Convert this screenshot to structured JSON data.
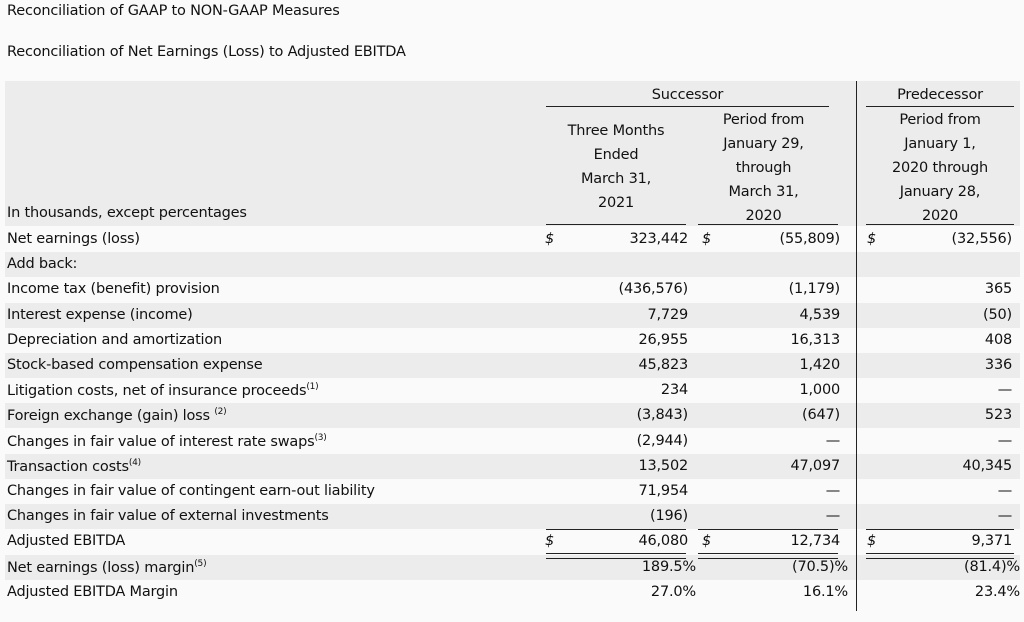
{
  "titles": {
    "main": "Reconciliation of GAAP to NON-GAAP Measures",
    "sub": "Reconciliation of Net Earnings (Loss) to Adjusted EBITDA"
  },
  "header": {
    "successor": "Successor",
    "predecessor": "Predecessor",
    "col1": [
      "Three Months",
      "Ended",
      "March 31,",
      "2021"
    ],
    "col2": [
      "Period from",
      "January 29,",
      "through",
      "March 31,",
      "2020"
    ],
    "col3": [
      "Period from",
      "January 1,",
      "2020 through",
      "January 28,",
      "2020"
    ],
    "units_label": "In thousands, except percentages"
  },
  "rows": [
    {
      "label": "Net earnings (loss)",
      "sup": "",
      "c1": "323,442",
      "c2": "(55,809)",
      "c3": "(32,556)",
      "dollar": "$"
    },
    {
      "label": "Add back:",
      "sup": "",
      "c1": "",
      "c2": "",
      "c3": ""
    },
    {
      "label": "Income tax (benefit) provision",
      "sup": "",
      "c1": "(436,576)",
      "c2": "(1,179)",
      "c3": "365"
    },
    {
      "label": "Interest expense (income)",
      "sup": "",
      "c1": "7,729",
      "c2": "4,539",
      "c3": "(50)"
    },
    {
      "label": "Depreciation and amortization",
      "sup": "",
      "c1": "26,955",
      "c2": "16,313",
      "c3": "408"
    },
    {
      "label": "Stock-based compensation expense",
      "sup": "",
      "c1": "45,823",
      "c2": "1,420",
      "c3": "336"
    },
    {
      "label": "Litigation costs, net of insurance proceeds",
      "sup": "(1)",
      "c1": "234",
      "c2": "1,000",
      "c3": "—"
    },
    {
      "label": "Foreign exchange (gain) loss ",
      "sup": "(2)",
      "c1": "(3,843)",
      "c2": "(647)",
      "c3": "523"
    },
    {
      "label": "Changes in fair value of interest rate swaps",
      "sup": "(3)",
      "c1": "(2,944)",
      "c2": "—",
      "c3": "—"
    },
    {
      "label": "Transaction costs",
      "sup": "(4)",
      "c1": "13,502",
      "c2": "47,097",
      "c3": "40,345"
    },
    {
      "label": "Changes in fair value of contingent earn-out liability",
      "sup": "",
      "c1": "71,954",
      "c2": "—",
      "c3": "—"
    },
    {
      "label": "Changes in fair value of external investments",
      "sup": "",
      "c1": "(196)",
      "c2": "—",
      "c3": "—"
    },
    {
      "label": "Adjusted EBITDA",
      "sup": "",
      "c1": "46,080",
      "c2": "12,734",
      "c3": "9,371",
      "dollar": "$"
    },
    {
      "label": "Net earnings (loss) margin",
      "sup": "(5)",
      "c1": "189.5%",
      "c2": "(70.5)%",
      "c3": "(81.4)%"
    },
    {
      "label": "Adjusted EBITDA Margin",
      "sup": "",
      "c1": "27.0%",
      "c2": "16.1%",
      "c3": "23.4%"
    }
  ]
}
